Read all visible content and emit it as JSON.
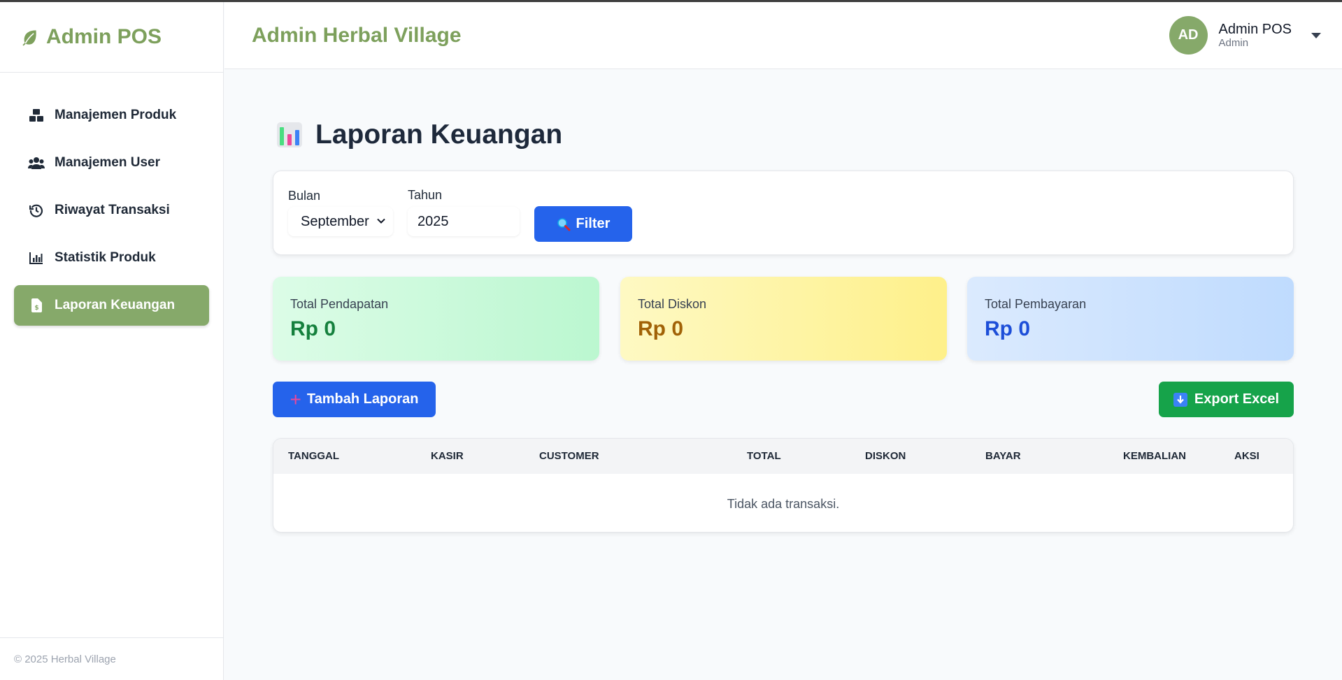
{
  "sidebar": {
    "brand": "Admin POS",
    "items": [
      {
        "label": "Manajemen Produk",
        "icon": "boxes-icon",
        "active": false
      },
      {
        "label": "Manajemen User",
        "icon": "users-icon",
        "active": false
      },
      {
        "label": "Riwayat Transaksi",
        "icon": "history-icon",
        "active": false
      },
      {
        "label": "Statistik Produk",
        "icon": "bar-chart-icon",
        "active": false
      },
      {
        "label": "Laporan Keuangan",
        "icon": "file-invoice-icon",
        "active": true
      }
    ],
    "footer": "© 2025 Herbal Village"
  },
  "header": {
    "title": "Admin Herbal Village",
    "user": {
      "initials": "AD",
      "name": "Admin POS",
      "role": "Admin"
    }
  },
  "page": {
    "title": "Laporan Keuangan",
    "filter": {
      "month_label": "Bulan",
      "month_value": "September",
      "year_label": "Tahun",
      "year_value": "2025",
      "button": "Filter"
    },
    "stats": [
      {
        "label": "Total Pendapatan",
        "value": "Rp 0",
        "color": "#15803d"
      },
      {
        "label": "Total Diskon",
        "value": "Rp 0",
        "color": "#a16207"
      },
      {
        "label": "Total Pembayaran",
        "value": "Rp 0",
        "color": "#1d4ed8"
      }
    ],
    "add_button": "Tambah Laporan",
    "export_button": "Export Excel",
    "table": {
      "columns": [
        "TANGGAL",
        "KASIR",
        "CUSTOMER",
        "TOTAL",
        "DISKON",
        "BAYAR",
        "KEMBALIAN",
        "AKSI"
      ],
      "empty_message": "Tidak ada transaksi."
    }
  },
  "colors": {
    "brand": "#7da05c",
    "active_nav": "#86a96a",
    "primary": "#2563eb",
    "success": "#16a34a"
  }
}
